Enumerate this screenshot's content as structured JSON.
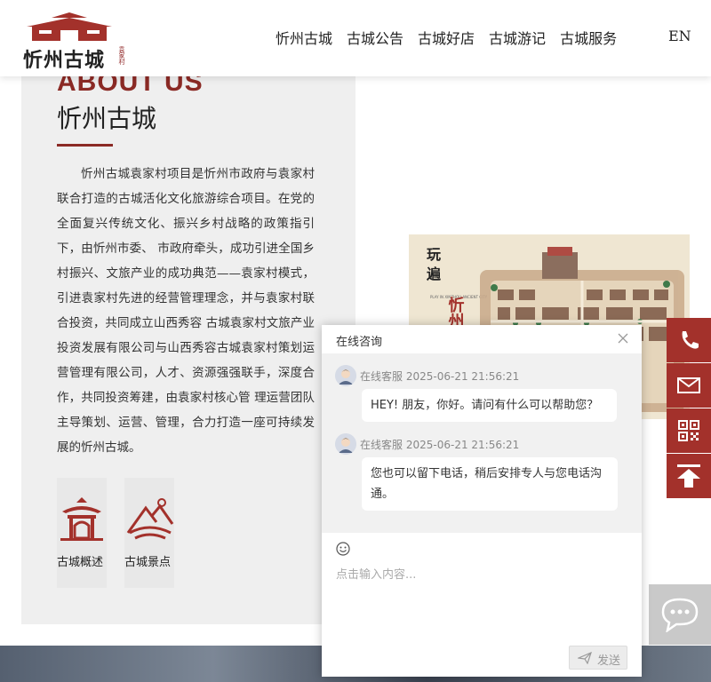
{
  "header": {
    "logo_text": "忻州古城",
    "logo_sub": "袁家村",
    "nav": [
      "忻州古城",
      "古城公告",
      "古城好店",
      "古城游记",
      "古城服务"
    ],
    "lang": "EN"
  },
  "about": {
    "title_en": "ABOUT US",
    "title_cn": "忻州古城",
    "intro": "忻州古城袁家村项目是忻州市政府与袁家村联合打造的古城活化文化旅游综合项目。在党的全面复兴传统文化、振兴乡村战略的政策指引下，由忻州市委、 市政府牵头，成功引进全国乡村振兴、文旅产业的成功典范——袁家村模式，引进袁家村先进的经营管理理念，并与袁家村联合投资，共同成立山西秀容 古城袁家村文旅产业投资发展有限公司与山西秀容古城袁家村策划运营管理有限公司，人才、资源强强联手，深度合作，共同投资筹建，由袁家村核心管 理运营团队主导策划、运营、管理，合力打造一座可持续发展的忻州古城。",
    "cards": [
      {
        "label": "古城概述",
        "icon": "pavilion-icon"
      },
      {
        "label": "古城景点",
        "icon": "mountain-icon"
      }
    ]
  },
  "map": {
    "label_1": "玩",
    "label_2": "遍",
    "label_title": "忻州古",
    "label_en": "PLAY IN XINZHOU ANCIENT CITY"
  },
  "float_bar": [
    "phone-icon",
    "mail-icon",
    "qrcode-icon",
    "back-to-top-icon"
  ],
  "chat": {
    "title": "在线咨询",
    "messages": [
      {
        "sender": "在线客服",
        "time": "2025-06-21 21:56:21",
        "text": "HEY! 朋友，你好。请问有什么可以帮助您？"
      },
      {
        "sender": "在线客服",
        "time": "2025-06-21 21:56:21",
        "text": "您也可以留下电话，稍后安排专人与您电话沟通。"
      }
    ],
    "placeholder": "点击输入内容...",
    "send": "发送"
  },
  "colors": {
    "brand_red": "#a3312b",
    "title_red": "#8b2a25",
    "panel_bg": "#efefef"
  }
}
